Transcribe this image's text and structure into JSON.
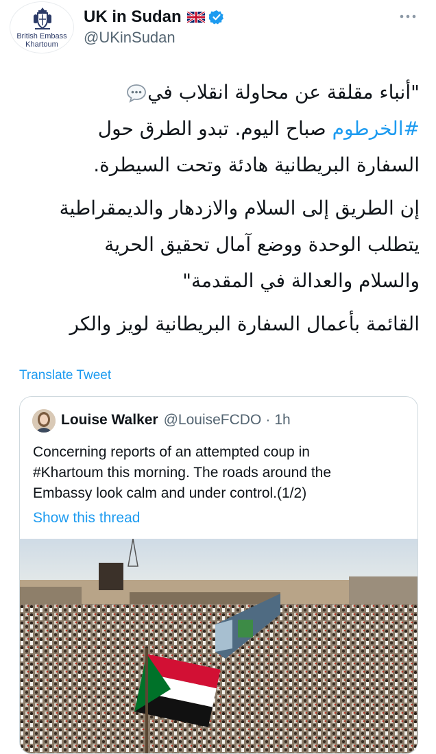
{
  "author": {
    "display_name": "UK in Sudan",
    "handle": "@UKinSudan",
    "avatar_line1": "British Embass",
    "avatar_line2": "Khartoum",
    "verified": true
  },
  "tweet": {
    "line1": "\"أنباء مقلقة عن محاولة انقلاب في",
    "hashtag": "#الخرطوم",
    "line2_rest": " صباح اليوم. تبدو الطرق حول",
    "line3": "السفارة البريطانية هادئة وتحت السيطرة.",
    "para2_line1": "إن الطريق إلى السلام والازدهار والديمقراطية",
    "para2_line2": "يتطلب الوحدة ووضع آمال تحقيق الحرية",
    "para2_line3": "والسلام والعدالة في المقدمة\"",
    "para3": "القائمة بأعمال السفارة البريطانية لويز والكر"
  },
  "translate_label": "Translate Tweet",
  "quoted_tweet": {
    "display_name": "Louise Walker",
    "handle": "@LouiseFCDO",
    "separator": "·",
    "time": "1h",
    "text_line1": "Concerning reports of an attempted coup in",
    "text_line2": "#Khartoum this morning. The roads around the",
    "text_line3": "Embassy look calm and under control.(1/2)",
    "show_thread": "Show this thread"
  },
  "icons": {
    "more": "more-dots-icon",
    "verified": "verified-badge-icon",
    "flag": "uk-flag-icon",
    "speech": "speech-bubble-icon"
  },
  "colors": {
    "accent": "#1d9bf0",
    "text": "#0f1419",
    "secondary": "#536471",
    "border": "#cfd9de"
  }
}
